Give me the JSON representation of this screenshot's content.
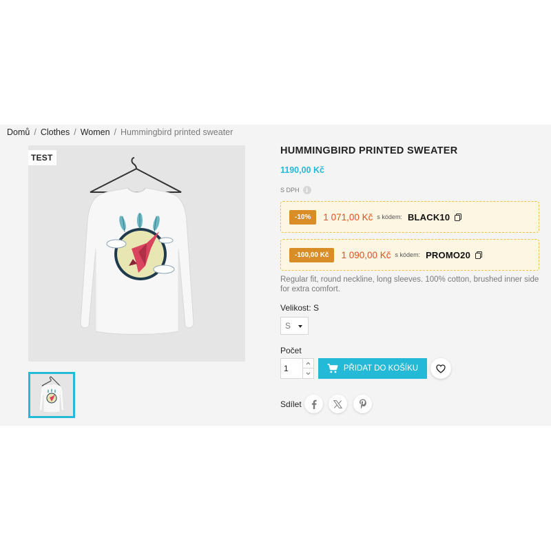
{
  "breadcrumb": {
    "items": [
      "Domů",
      "Clothes",
      "Women"
    ],
    "current": "Hummingbird printed sweater",
    "separator": "/"
  },
  "product": {
    "badge": "TEST",
    "title": "HUMMINGBIRD PRINTED SWEATER",
    "price": "1190,00 Kč",
    "tax_label": "S DPH",
    "tax_info_icon": "info-icon",
    "description": "Regular fit, round neckline, long sleeves. 100% cotton, brushed inner side for extra comfort."
  },
  "promos": [
    {
      "chip": "-10%",
      "price": "1 071,00 Kč",
      "label": "s kódem:",
      "code": "BLACK10",
      "icon": "copy-icon"
    },
    {
      "chip": "-100,00 Kč",
      "price": "1 090,00 Kč",
      "label": "s kódem:",
      "code": "PROMO20",
      "icon": "copy-icon"
    }
  ],
  "size": {
    "label": "Velikost: S",
    "selected": "S"
  },
  "quantity": {
    "label": "Počet",
    "value": "1"
  },
  "cart": {
    "add_label": "PŘIDAT DO KOŠÍKU",
    "icon": "cart-icon"
  },
  "wishlist": {
    "icon": "heart-icon"
  },
  "share": {
    "label": "Sdílet",
    "icons": [
      "facebook-icon",
      "x-icon",
      "pinterest-icon"
    ]
  },
  "colors": {
    "accent": "#24b9d7",
    "promo_chip": "#d88d26",
    "promo_price": "#e4501c",
    "promo_border": "#f0c040",
    "promo_bg": "#fdf6e3"
  }
}
